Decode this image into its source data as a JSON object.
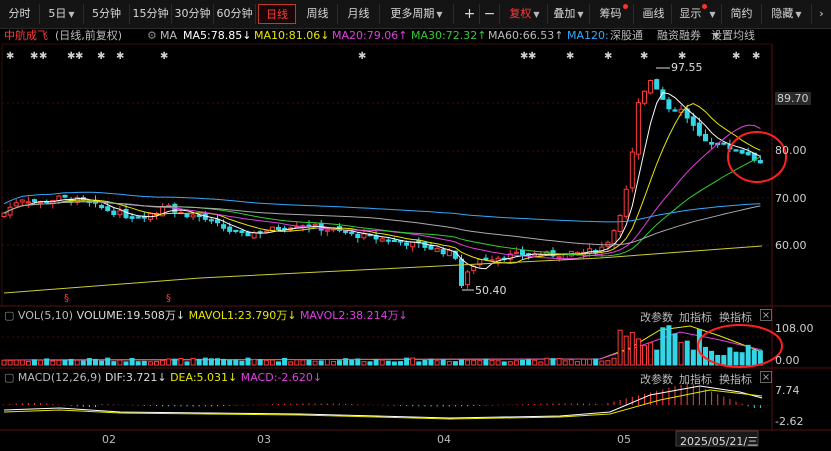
{
  "toolbar": {
    "buttons": [
      "分时",
      "5日",
      "5分钟",
      "15分钟",
      "30分钟",
      "60分钟",
      "日线",
      "周线",
      "月线",
      "更多周期",
      "+",
      "−",
      "复权",
      "叠加",
      "筹码",
      "画线",
      "显示",
      "简约",
      "隐藏"
    ],
    "active": "日线"
  },
  "info": {
    "stock": "中航成飞",
    "mode": "(日线,前复权)",
    "ma_label": "MA",
    "ma5": "MA5:78.85↓",
    "ma10": "MA10:81.06↓",
    "ma20": "MA20:79.06↑",
    "ma30": "MA30:72.32↑",
    "ma60": "MA60:66.53↑",
    "ma120": "MA120:6",
    "links": [
      "深股通",
      "融资融券",
      "设置均线"
    ]
  },
  "main_chart": {
    "high_label": "97.55",
    "low_label": "50.40",
    "y_ticks": [
      "89.70",
      "80.00",
      "70.00",
      "60.00"
    ]
  },
  "volume_panel": {
    "label": "VOL(5,10)",
    "volume": "VOLUME:19.508万↓",
    "mavol1": "MAVOL1:23.790万↓",
    "mavol2": "MAVOL2:38.214万↓",
    "actions": [
      "改参数",
      "加指标",
      "换指标"
    ],
    "y_ticks": [
      "108.00",
      "0.00"
    ]
  },
  "macd_panel": {
    "label": "MACD(12,26,9)",
    "dif": "DIF:3.721↓",
    "dea": "DEA:5.031↓",
    "macd": "MACD:-2.620↓",
    "actions": [
      "改参数",
      "加指标",
      "换指标"
    ],
    "y_ticks": [
      "7.74",
      "-2.62"
    ]
  },
  "x_axis": {
    "months": [
      "02",
      "03",
      "04",
      "05"
    ],
    "cursor_date": "2025/05/21/三"
  },
  "colors": {
    "up": "#ff3b3b",
    "down": "#33d6e6",
    "ma5": "#ffffff",
    "ma10": "#e8e800",
    "ma20": "#e040e0",
    "ma30": "#33cc33",
    "ma60": "#aaaaaa",
    "ma120": "#33aaff",
    "ma250": "#cccc33",
    "highlight_circle": "#ff2020"
  }
}
